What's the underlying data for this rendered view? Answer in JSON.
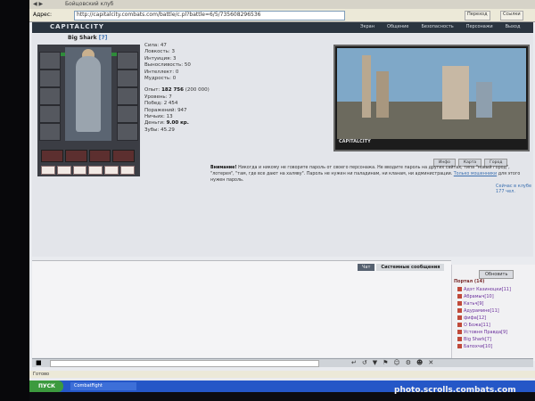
{
  "browser": {
    "tab_title": "Бойцовский клуб",
    "address_label": "Адрес:",
    "url": "http://capitalcity.combats.com/battle/c.pl?battle=6/5/735608296536",
    "btn_go": "Переход",
    "btn_links": "Ссылки"
  },
  "game": {
    "logo": "CAPITALCITY",
    "nav": [
      "Экран",
      "Общение",
      "Безопасность",
      "Персонажи",
      "Выход"
    ],
    "character": {
      "nick": "Big Shark",
      "level": "[7]",
      "hp": "1139/1139",
      "stats": [
        {
          "label": "Сила:",
          "value": "47"
        },
        {
          "label": "Ловкость:",
          "value": "3"
        },
        {
          "label": "Интуиция:",
          "value": "3"
        },
        {
          "label": "Выносливость:",
          "value": "50"
        },
        {
          "label": "Интеллект:",
          "value": "0"
        },
        {
          "label": "Мудрость:",
          "value": "0"
        }
      ],
      "record": [
        {
          "label": "Опыт:",
          "value": "182 756",
          "extra": "(200 000)"
        },
        {
          "label": "Уровень:",
          "value": "7"
        },
        {
          "label": "Побед:",
          "value": "2 454"
        },
        {
          "label": "Поражений:",
          "value": "947"
        },
        {
          "label": "Ничьих:",
          "value": "13"
        },
        {
          "label": "Деньги:",
          "value": "9.00 кр."
        },
        {
          "label": "Зубы:",
          "value": "45.29"
        }
      ]
    },
    "scene_caption": "CAPITALCITY",
    "scene_buttons": [
      "Инфо",
      "Карта",
      "Город"
    ],
    "warning_bold": "Внимание!",
    "warning_text": "Никогда и никому не говорите пароль от своего персонажа. Не вводите пароль на других сайтах, типа \"новый город\", \"лотерея\", \"там, где все дают на халяву\". Пароль не нужен ни паладинам, ни кланам, ни администрации.",
    "warning_link": "Только мошенники",
    "warning_tail": "для этого нужен пароль.",
    "online": "Сейчас в клубе 177 чел."
  },
  "chat": {
    "tabs": [
      "Чат",
      "Системные сообщения"
    ],
    "refresh": "Обновить",
    "room": "Портал (14)",
    "players": [
      "Адэт Казиноцки[11]",
      "Абрамыч[10]",
      "Катьч[9]",
      "Адурамине[11]",
      "фифа[12]",
      "О Божа[11]",
      "Устовня Правда[9]",
      "Big Shark[7]",
      "Бапохчи[10]"
    ]
  },
  "statusbar": {
    "text": "Готово"
  },
  "taskbar": {
    "start": "ПУСК",
    "task": "CombatFight"
  },
  "watermark": "photo.scrolls.combats.com"
}
